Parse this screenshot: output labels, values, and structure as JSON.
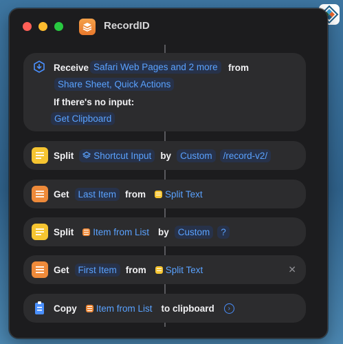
{
  "window": {
    "title": "RecordID"
  },
  "receive": {
    "label": "Receive",
    "input_types": "Safari Web Pages and 2 more",
    "from_label": "from",
    "sources": "Share Sheet, Quick Actions",
    "no_input_label": "If there's no input:",
    "fallback": "Get Clipboard"
  },
  "actions": [
    {
      "verb": "Split",
      "input": "Shortcut Input",
      "by_label": "by",
      "mode": "Custom",
      "separator": "/record-v2/"
    },
    {
      "verb": "Get",
      "item": "Last Item",
      "from_label": "from",
      "source": "Split Text"
    },
    {
      "verb": "Split",
      "input": "Item from List",
      "by_label": "by",
      "mode": "Custom",
      "separator": "?"
    },
    {
      "verb": "Get",
      "item": "First Item",
      "from_label": "from",
      "source": "Split Text"
    },
    {
      "verb": "Copy",
      "input": "Item from List",
      "suffix": "to clipboard"
    }
  ],
  "colors": {
    "accent": "#5aa2ff",
    "split_icon": "#f6c531",
    "list_icon": "#ee8a3a",
    "card": "#2c2c2e"
  }
}
